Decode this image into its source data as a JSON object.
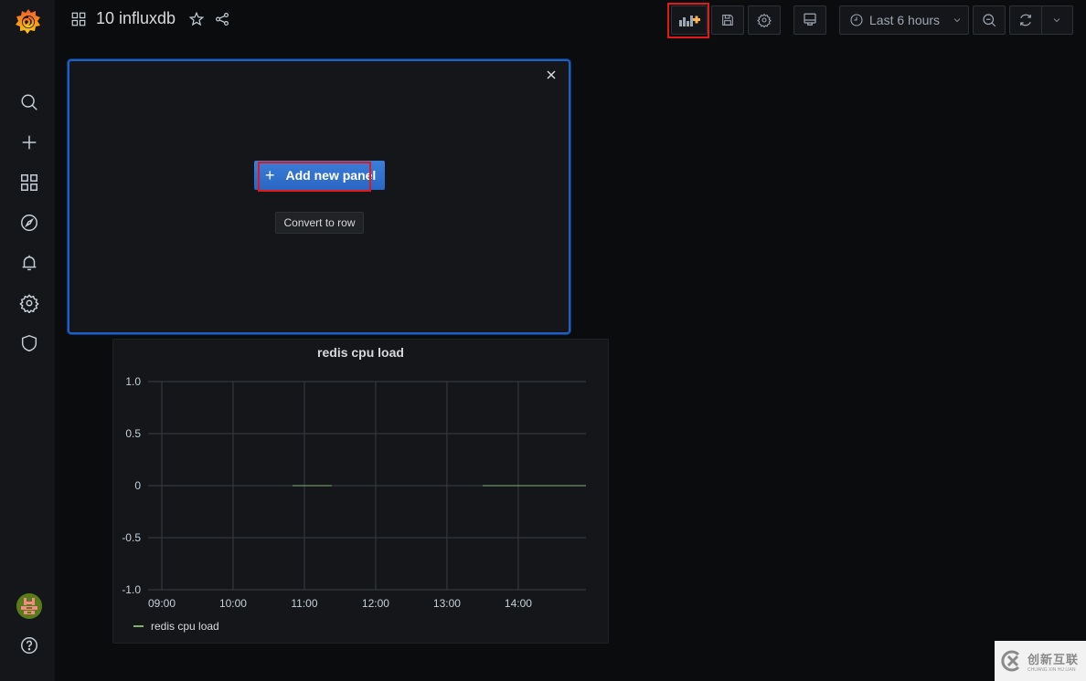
{
  "app": {
    "name": "Grafana"
  },
  "header": {
    "dashboard_title": "10 influxdb",
    "time_range": "Last 6 hours"
  },
  "toolbar": {
    "buttons": [
      {
        "name": "add-panel",
        "icon": "add-panel-icon",
        "highlighted": true
      },
      {
        "name": "save-dashboard",
        "icon": "save-icon"
      },
      {
        "name": "dashboard-settings",
        "icon": "gear-icon"
      },
      {
        "name": "cycle-view-mode",
        "icon": "monitor-icon"
      },
      {
        "name": "time-picker",
        "icon": "clock-icon"
      },
      {
        "name": "zoom-out",
        "icon": "zoom-out-icon"
      },
      {
        "name": "refresh",
        "icon": "refresh-icon"
      },
      {
        "name": "refresh-interval",
        "icon": "chevron-down-icon"
      }
    ]
  },
  "sidebar": {
    "items": [
      {
        "name": "search",
        "icon": "search-icon"
      },
      {
        "name": "create",
        "icon": "plus-icon"
      },
      {
        "name": "dashboards",
        "icon": "grid-icon"
      },
      {
        "name": "explore",
        "icon": "compass-icon"
      },
      {
        "name": "alerting",
        "icon": "bell-icon"
      },
      {
        "name": "configuration",
        "icon": "gear-icon"
      },
      {
        "name": "server-admin",
        "icon": "shield-icon"
      }
    ],
    "bottom": [
      {
        "name": "profile",
        "icon": "avatar"
      },
      {
        "name": "help",
        "icon": "help-icon"
      }
    ]
  },
  "new_panel": {
    "add_label": "Add new panel",
    "add_icon": "+",
    "convert_label": "Convert to row",
    "close_icon": "×"
  },
  "colors": {
    "accent_blue": "#3274d9",
    "highlight_red": "#e0191a",
    "series_green": "#7eb26d",
    "add_panel_plus": "#ffb357"
  },
  "chart_data": {
    "type": "line",
    "title": "redis cpu load",
    "xlabel": "",
    "ylabel": "",
    "ylim": [
      -1.0,
      1.0
    ],
    "xlim": [
      "08:50",
      "14:57"
    ],
    "y_ticks": [
      "1.0",
      "0.5",
      "0",
      "-0.5",
      "-1.0"
    ],
    "y_tick_values": [
      1.0,
      0.5,
      0,
      -0.5,
      -1.0
    ],
    "x_ticks": [
      "09:00",
      "10:00",
      "11:00",
      "12:00",
      "13:00",
      "14:00"
    ],
    "grid": true,
    "legend": {
      "placement": "bottom-left",
      "entries": [
        "redis cpu load"
      ]
    },
    "series": [
      {
        "name": "redis cpu load",
        "color": "#7eb26d",
        "segments": [
          {
            "x": [
              "10:50",
              "11:23"
            ],
            "y": [
              0,
              0
            ]
          },
          {
            "x": [
              "13:30",
              "14:57"
            ],
            "y": [
              0,
              0
            ]
          }
        ]
      }
    ]
  },
  "watermark": {
    "cn": "创新互联",
    "en": "CHUANG XIN HU LIAN"
  }
}
